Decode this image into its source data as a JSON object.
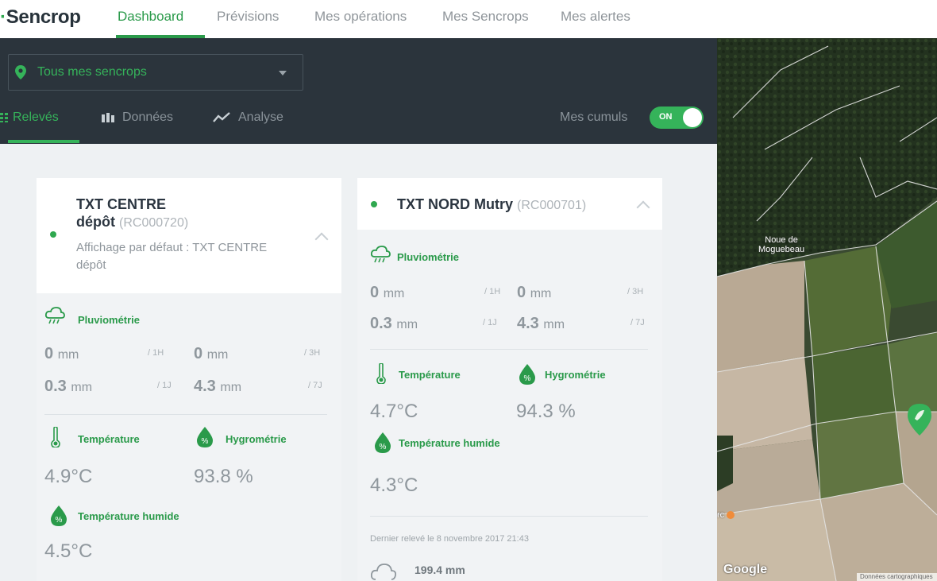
{
  "nav": {
    "brand": "Sencrop",
    "links": [
      "Dashboard",
      "Prévisions",
      "Mes opérations",
      "Mes Sencrops",
      "Mes alertes"
    ],
    "active": "Dashboard"
  },
  "header": {
    "station_select": "Tous mes sencrops",
    "subtabs": [
      "Relevés",
      "Données",
      "Analyse"
    ],
    "cumuls_label": "Mes cumuls",
    "toggle": "ON"
  },
  "cards": [
    {
      "name_line1": "TXT CENTRE",
      "name_line2": "dépôt",
      "code": "(RC000720)",
      "default_line1": "Affichage par défaut : TXT CENTRE",
      "default_line2": "dépôt",
      "pluvio_label": "Pluviométrie",
      "rain": [
        {
          "value": "0",
          "unit": "mm",
          "period": "/ 1H"
        },
        {
          "value": "0",
          "unit": "mm",
          "period": "/ 3H"
        },
        {
          "value": "0.3",
          "unit": "mm",
          "period": "/ 1J"
        },
        {
          "value": "4.3",
          "unit": "mm",
          "period": "/ 7J"
        }
      ],
      "temp_label": "Température",
      "temp_value": "4.9°C",
      "hygro_label": "Hygrométrie",
      "hygro_value": "93.8 %",
      "wet_label": "Température humide",
      "wet_value": "4.5°C"
    },
    {
      "name": "TXT NORD Mutry",
      "code": "(RC000701)",
      "pluvio_label": "Pluviométrie",
      "rain": [
        {
          "value": "0",
          "unit": "mm",
          "period": "/ 1H"
        },
        {
          "value": "0",
          "unit": "mm",
          "period": "/ 3H"
        },
        {
          "value": "0.3",
          "unit": "mm",
          "period": "/ 1J"
        },
        {
          "value": "4.3",
          "unit": "mm",
          "period": "/ 7J"
        }
      ],
      "temp_label": "Température",
      "temp_value": "4.7°C",
      "hygro_label": "Hygrométrie",
      "hygro_value": "94.3 %",
      "wet_label": "Température humide",
      "wet_value": "4.3°C",
      "last_reading": "Dernier relevé le 8 novembre 2017 21:43",
      "cumul_value": "199.4 mm"
    }
  ],
  "map": {
    "place_label_line1": "Noue de",
    "place_label_line2": "Moguebeau",
    "partial_label": "rc",
    "google": "Google",
    "attribution": "Données cartographiques"
  },
  "colors": {
    "accent": "#2a9a4a",
    "dark_header": "#2b343c",
    "content_bg": "#eef1f3"
  }
}
